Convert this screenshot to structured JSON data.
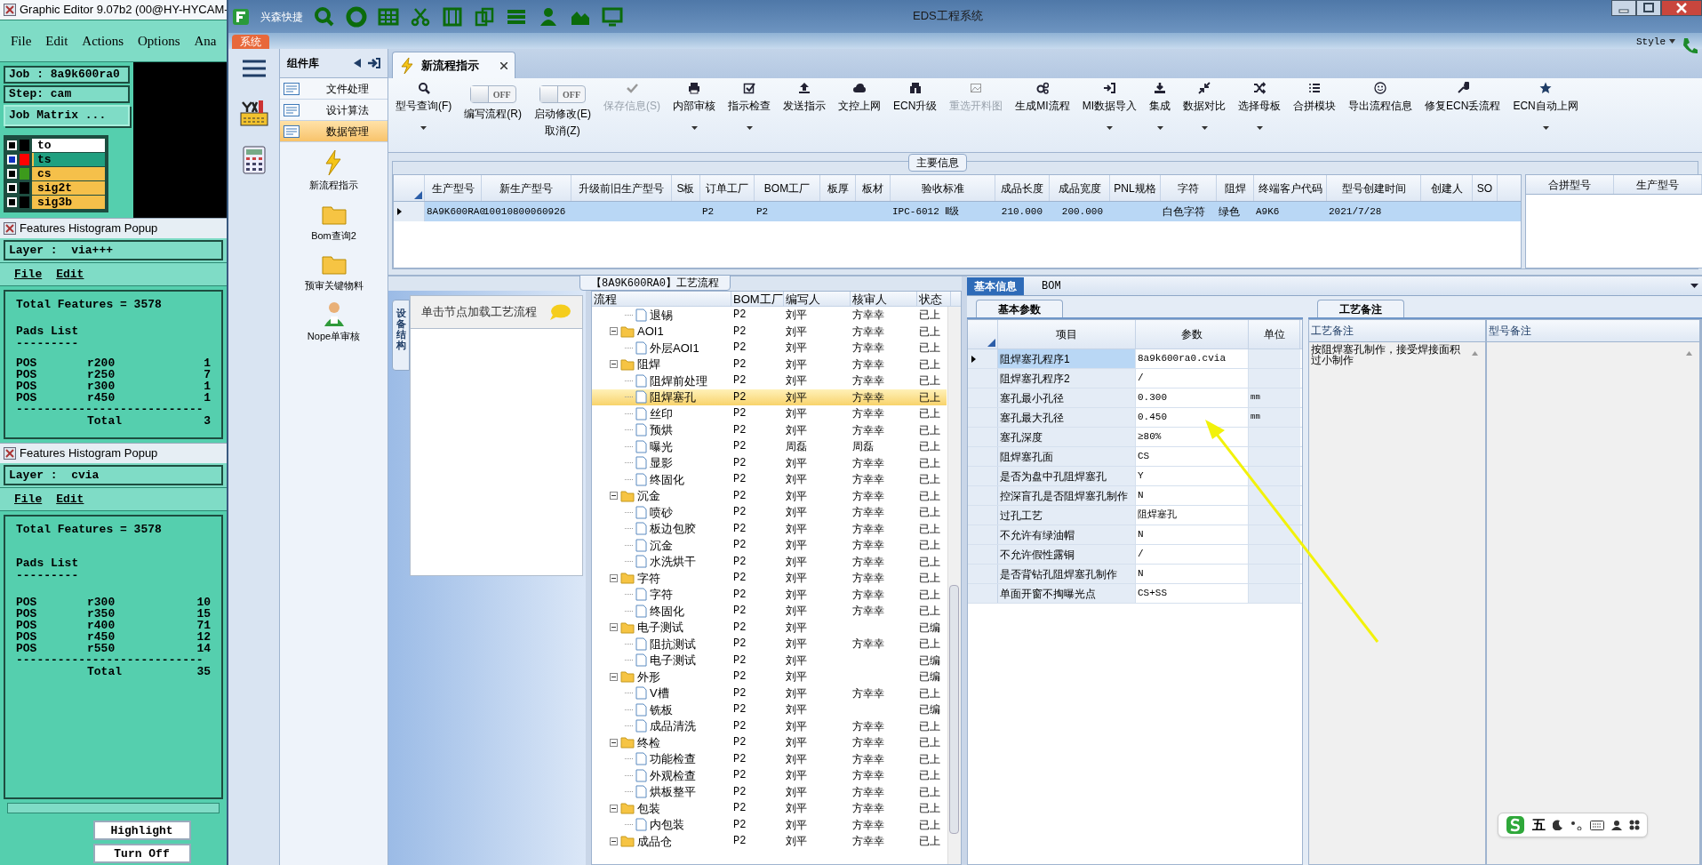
{
  "graphic_editor": {
    "title": "Graphic Editor 9.07b2 (00@HY-HYCAM-",
    "menu": [
      "File",
      "Edit",
      "Actions",
      "Options",
      "Ana"
    ],
    "job": "Job : 8a9k600ra0",
    "step": "Step: cam",
    "job_matrix": "Job Matrix ...",
    "layers": [
      {
        "name": "to",
        "kind": "board",
        "color": "#000000",
        "checked": false,
        "selected": false
      },
      {
        "name": "ts",
        "kind": "signal",
        "color": "#ff0000",
        "checked": true,
        "selected": true
      },
      {
        "name": "cs",
        "kind": "signal",
        "color": "#3c9a1c",
        "checked": false,
        "selected": false
      },
      {
        "name": "sig2t",
        "kind": "signal",
        "color": "#000000",
        "checked": false,
        "selected": false
      },
      {
        "name": "sig3b",
        "kind": "signal",
        "color": "#000000",
        "checked": false,
        "selected": false
      }
    ],
    "popups": [
      {
        "title": "Features Histogram Popup",
        "layer": "Layer :  via+++",
        "menu": [
          "File",
          "Edit"
        ],
        "total_features": "Total Features = 3578",
        "list_title": "Pads List",
        "underline": "---------",
        "rows": [
          {
            "type": "POS",
            "symbol": "r200",
            "count": "1"
          },
          {
            "type": "POS",
            "symbol": "r250",
            "count": "7"
          },
          {
            "type": "POS",
            "symbol": "r300",
            "count": "1"
          },
          {
            "type": "POS",
            "symbol": "r450",
            "count": "1"
          }
        ],
        "separator": "---------------------------",
        "total_label": "Total",
        "total_value": "3"
      },
      {
        "title": "Features Histogram Popup",
        "layer": "Layer :  cvia",
        "menu": [
          "File",
          "Edit"
        ],
        "total_features": "Total Features = 3578",
        "list_title": "Pads List",
        "underline": "---------",
        "rows": [
          {
            "type": "POS",
            "symbol": "r300",
            "count": "10"
          },
          {
            "type": "POS",
            "symbol": "r350",
            "count": "15"
          },
          {
            "type": "POS",
            "symbol": "r400",
            "count": "71"
          },
          {
            "type": "POS",
            "symbol": "r450",
            "count": "12"
          },
          {
            "type": "POS",
            "symbol": "r550",
            "count": "14"
          }
        ],
        "separator": "---------------------------",
        "total_label": "Total",
        "total_value": "35"
      }
    ],
    "buttons": [
      "Highlight",
      "Turn Off"
    ]
  },
  "app": {
    "title": "EDS工程系统",
    "quick_access": "兴森快捷",
    "menu_tab": "系统",
    "style_menu": "Style"
  },
  "sidebar": {
    "title": "组件库",
    "items": [
      {
        "label": "文件处理",
        "selected": false
      },
      {
        "label": "设计算法",
        "selected": false
      },
      {
        "label": "数据管理",
        "selected": true
      }
    ],
    "tools": [
      "新流程指示",
      "Bom查询2",
      "预审关键物料",
      "Nope单审核"
    ]
  },
  "tabs": [
    {
      "label": "新流程指示",
      "selected": true
    }
  ],
  "toolbar": [
    {
      "kind": "button",
      "label": "型号查询(F)",
      "dropdown": true,
      "disabled": false
    },
    {
      "kind": "toggle",
      "label": "编写流程(R)",
      "state_text": "OFF",
      "on": false
    },
    {
      "kind": "toggle",
      "label": "启动修改(E)",
      "sublabel": "取消(Z)",
      "state_text": "OFF",
      "on": false
    },
    {
      "kind": "button",
      "label": "保存信息(S)",
      "dropdown": false,
      "disabled": true
    },
    {
      "kind": "button",
      "label": "内部审核",
      "dropdown": true,
      "disabled": false
    },
    {
      "kind": "button",
      "label": "指示检查",
      "dropdown": true,
      "disabled": false
    },
    {
      "kind": "button",
      "label": "发送指示",
      "dropdown": false,
      "disabled": false
    },
    {
      "kind": "button",
      "label": "文控上网",
      "dropdown": false,
      "disabled": false
    },
    {
      "kind": "button",
      "label": "ECN升级",
      "dropdown": false,
      "disabled": false
    },
    {
      "kind": "button",
      "label": "重选开料图",
      "dropdown": false,
      "disabled": true
    },
    {
      "kind": "button",
      "label": "生成MI流程",
      "dropdown": false,
      "disabled": false
    },
    {
      "kind": "button",
      "label": "MI数据导入",
      "dropdown": true,
      "disabled": false
    },
    {
      "kind": "button",
      "label": "集成",
      "dropdown": true,
      "disabled": false
    },
    {
      "kind": "button",
      "label": "数据对比",
      "dropdown": true,
      "disabled": false
    },
    {
      "kind": "button",
      "label": "选择母板",
      "dropdown": true,
      "disabled": false
    },
    {
      "kind": "button",
      "label": "合拼模块",
      "dropdown": false,
      "disabled": false
    },
    {
      "kind": "button",
      "label": "导出流程信息",
      "dropdown": false,
      "disabled": false
    },
    {
      "kind": "button",
      "label": "修复ECN丢流程",
      "dropdown": false,
      "disabled": false
    },
    {
      "kind": "button",
      "label": "ECN自动上网",
      "dropdown": true,
      "disabled": false
    }
  ],
  "main_info": {
    "title": "主要信息",
    "columns": [
      "生产型号",
      "新生产型号",
      "升级前旧生产型号",
      "S板",
      "订单工厂",
      "BOM工厂",
      "板厚",
      "板材",
      "验收标准",
      "成品长度",
      "成品宽度",
      "PNL规格",
      "字符",
      "阻焊",
      "终端客户代码",
      "型号创建时间",
      "创建人",
      "SO"
    ],
    "rows": [
      {
        "selected": true,
        "cells": [
          "8A9K600RA0",
          "10010800060926",
          null,
          null,
          "P2",
          "P2",
          null,
          null,
          "IPC-6012 Ⅱ级",
          "210.000",
          "200.000",
          null,
          "白色字符",
          "绿色",
          "A9K6",
          "2021/7/28",
          null,
          null
        ]
      }
    ],
    "side_columns": [
      "合拼型号",
      "生产型号"
    ]
  },
  "process": {
    "title": "【8A9K600RA0】工艺流程",
    "side_tab": "设备结构",
    "hint": "单击节点加载工艺流程",
    "columns": [
      "流程",
      "BOM工厂",
      "编写人",
      "核审人",
      "状态"
    ],
    "nodes": [
      {
        "children": [
          {
            "name": "退锡",
            "bom": "P2",
            "writer": "刘平",
            "reviewer": "方幸幸",
            "status": "已上",
            "selected": false
          }
        ]
      },
      {
        "name": "AOI1",
        "bom": "P2",
        "writer": "刘平",
        "reviewer": "方幸幸",
        "status": "已上",
        "selected": false,
        "expanded": true,
        "children": [
          {
            "name": "外层AOI1",
            "bom": "P2",
            "writer": "刘平",
            "reviewer": "方幸幸",
            "status": "已上",
            "selected": false
          }
        ]
      },
      {
        "name": "阻焊",
        "bom": "P2",
        "writer": "刘平",
        "reviewer": "方幸幸",
        "status": "已上",
        "selected": false,
        "expanded": true,
        "children": [
          {
            "name": "阻焊前处理",
            "bom": "P2",
            "writer": "刘平",
            "reviewer": "方幸幸",
            "status": "已上",
            "selected": false
          },
          {
            "name": "阻焊塞孔",
            "bom": "P2",
            "writer": "刘平",
            "reviewer": "方幸幸",
            "status": "已上",
            "selected": true
          },
          {
            "name": "丝印",
            "bom": "P2",
            "writer": "刘平",
            "reviewer": "方幸幸",
            "status": "已上",
            "selected": false
          },
          {
            "name": "预烘",
            "bom": "P2",
            "writer": "刘平",
            "reviewer": "方幸幸",
            "status": "已上",
            "selected": false
          },
          {
            "name": "曝光",
            "bom": "P2",
            "writer": "周磊",
            "reviewer": "周磊",
            "status": "已上",
            "selected": false
          },
          {
            "name": "显影",
            "bom": "P2",
            "writer": "刘平",
            "reviewer": "方幸幸",
            "status": "已上",
            "selected": false
          },
          {
            "name": "终固化",
            "bom": "P2",
            "writer": "刘平",
            "reviewer": "方幸幸",
            "status": "已上",
            "selected": false
          }
        ]
      },
      {
        "name": "沉金",
        "bom": "P2",
        "writer": "刘平",
        "reviewer": "方幸幸",
        "status": "已上",
        "selected": false,
        "expanded": true,
        "children": [
          {
            "name": "喷砂",
            "bom": "P2",
            "writer": "刘平",
            "reviewer": "方幸幸",
            "status": "已上",
            "selected": false
          },
          {
            "name": "板边包胶",
            "bom": "P2",
            "writer": "刘平",
            "reviewer": "方幸幸",
            "status": "已上",
            "selected": false
          },
          {
            "name": "沉金",
            "bom": "P2",
            "writer": "刘平",
            "reviewer": "方幸幸",
            "status": "已上",
            "selected": false
          },
          {
            "name": "水洗烘干",
            "bom": "P2",
            "writer": "刘平",
            "reviewer": "方幸幸",
            "status": "已上",
            "selected": false
          }
        ]
      },
      {
        "name": "字符",
        "bom": "P2",
        "writer": "刘平",
        "reviewer": "方幸幸",
        "status": "已上",
        "selected": false,
        "expanded": true,
        "children": [
          {
            "name": "字符",
            "bom": "P2",
            "writer": "刘平",
            "reviewer": "方幸幸",
            "status": "已上",
            "selected": false
          },
          {
            "name": "终固化",
            "bom": "P2",
            "writer": "刘平",
            "reviewer": "方幸幸",
            "status": "已上",
            "selected": false
          }
        ]
      },
      {
        "name": "电子测试",
        "bom": "P2",
        "writer": "刘平",
        "status": "已编",
        "selected": false,
        "expanded": true,
        "children": [
          {
            "name": "阻抗测试",
            "bom": "P2",
            "writer": "刘平",
            "reviewer": "方幸幸",
            "status": "已上",
            "selected": false
          },
          {
            "name": "电子测试",
            "bom": "P2",
            "writer": "刘平",
            "status": "已编",
            "selected": false
          }
        ]
      },
      {
        "name": "外形",
        "bom": "P2",
        "writer": "刘平",
        "status": "已编",
        "selected": false,
        "expanded": true,
        "children": [
          {
            "name": "V槽",
            "bom": "P2",
            "writer": "刘平",
            "reviewer": "方幸幸",
            "status": "已上",
            "selected": false
          },
          {
            "name": "铣板",
            "bom": "P2",
            "writer": "刘平",
            "status": "已编",
            "selected": false
          },
          {
            "name": "成品清洗",
            "bom": "P2",
            "writer": "刘平",
            "reviewer": "方幸幸",
            "status": "已上",
            "selected": false
          }
        ]
      },
      {
        "name": "终检",
        "bom": "P2",
        "writer": "刘平",
        "reviewer": "方幸幸",
        "status": "已上",
        "selected": false,
        "expanded": true,
        "children": [
          {
            "name": "功能检查",
            "bom": "P2",
            "writer": "刘平",
            "reviewer": "方幸幸",
            "status": "已上",
            "selected": false
          },
          {
            "name": "外观检查",
            "bom": "P2",
            "writer": "刘平",
            "reviewer": "方幸幸",
            "status": "已上",
            "selected": false
          },
          {
            "name": "烘板整平",
            "bom": "P2",
            "writer": "刘平",
            "reviewer": "方幸幸",
            "status": "已上",
            "selected": false
          }
        ]
      },
      {
        "name": "包装",
        "bom": "P2",
        "writer": "刘平",
        "reviewer": "方幸幸",
        "status": "已上",
        "selected": false,
        "expanded": true,
        "children": [
          {
            "name": "内包装",
            "bom": "P2",
            "writer": "刘平",
            "reviewer": "方幸幸",
            "status": "已上",
            "selected": false
          }
        ]
      },
      {
        "name": "成品仓",
        "bom": "P2",
        "writer": "刘平",
        "reviewer": "方幸幸",
        "status": "已上",
        "selected": false,
        "expanded": true
      }
    ]
  },
  "detail": {
    "tabs": [
      {
        "label": "基本信息",
        "selected": true
      },
      {
        "label": "BOM",
        "selected": false
      }
    ],
    "params_tab": "基本参数",
    "columns": [
      "项目",
      "参数",
      "单位"
    ],
    "params": [
      {
        "item": "阻焊塞孔程序1",
        "value": "8a9k600ra0.cvia",
        "selected": true
      },
      {
        "item": "阻焊塞孔程序2",
        "value": "/",
        "selected": false
      },
      {
        "item": "塞孔最小孔径",
        "value": "0.300",
        "unit": "mm",
        "selected": false
      },
      {
        "item": "塞孔最大孔径",
        "value": "0.450",
        "unit": "mm",
        "selected": false
      },
      {
        "item": "塞孔深度",
        "value": "≥80%",
        "selected": false
      },
      {
        "item": "阻焊塞孔面",
        "value": "CS",
        "selected": false
      },
      {
        "item": "是否为盘中孔阻焊塞孔",
        "value": "Y",
        "selected": false
      },
      {
        "item": "控深盲孔是否阻焊塞孔制作",
        "value": "N",
        "selected": false
      },
      {
        "item": "过孔工艺",
        "value": "阻焊塞孔",
        "selected": false
      },
      {
        "item": "不允许有绿油帽",
        "value": "N",
        "selected": false
      },
      {
        "item": "不允许假性露铜",
        "value": "/",
        "selected": false
      },
      {
        "item": "是否背钻孔阻焊塞孔制作",
        "value": "N",
        "selected": false
      },
      {
        "item": "单面开窗不掏曝光点",
        "value": "CS+SS",
        "selected": false
      }
    ],
    "notes_tab": "工艺备注",
    "notes_columns": [
      "工艺备注",
      "型号备注"
    ],
    "process_note": "按阻焊塞孔制作，接受焊接面积过小制作"
  },
  "ime_toolbar": {
    "mode": "五"
  }
}
